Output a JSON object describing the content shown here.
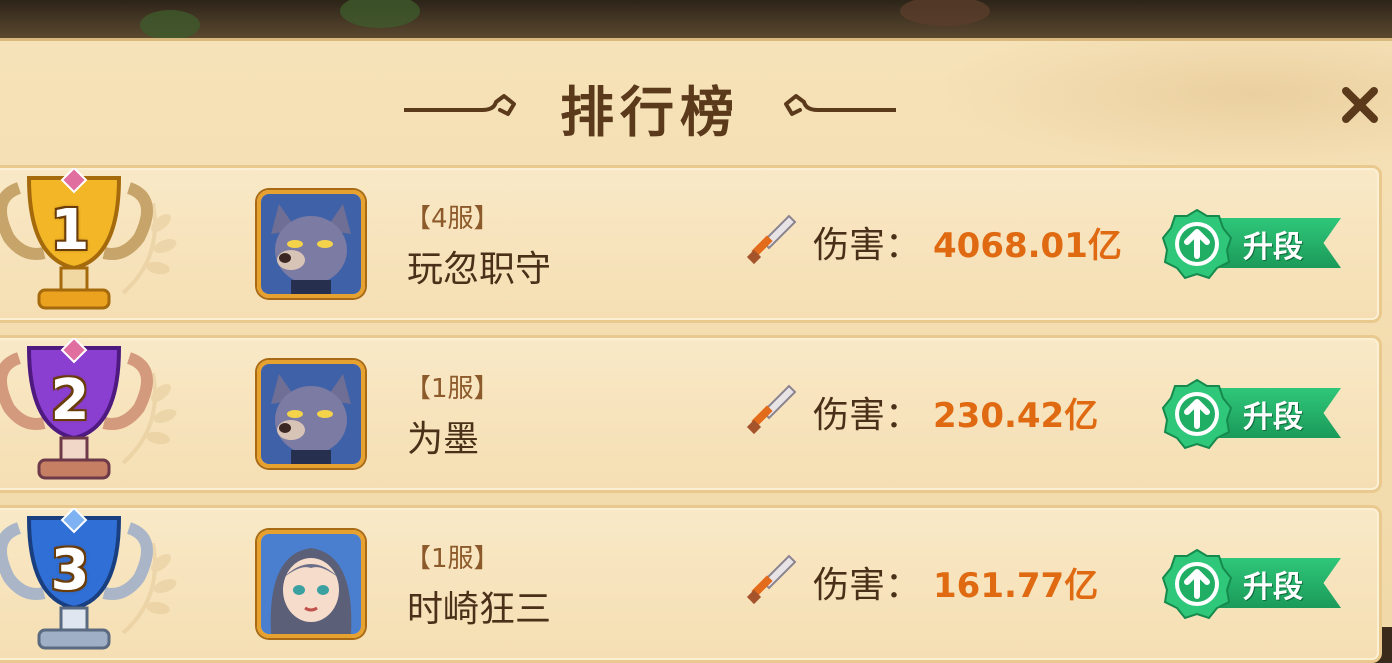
{
  "window": {
    "title": "排行榜",
    "close_label": "✕"
  },
  "leaderboard": {
    "damage_label": "伤害：",
    "rows": [
      {
        "rank": "1",
        "server": "【4服】",
        "name": "玩忽职守",
        "damage": "4068.01亿",
        "action_label": "升段",
        "trophy": "gold-trophy-icon",
        "avatar": "wolf-avatar"
      },
      {
        "rank": "2",
        "server": "【1服】",
        "name": "为墨",
        "damage": "230.42亿",
        "action_label": "升段",
        "trophy": "purple-trophy-icon",
        "avatar": "wolf-avatar"
      },
      {
        "rank": "3",
        "server": "【1服】",
        "name": "时崎狂三",
        "damage": "161.77亿",
        "action_label": "升段",
        "trophy": "blue-trophy-icon",
        "avatar": "girl-avatar"
      }
    ]
  },
  "colors": {
    "panel": "#f5deb2",
    "title": "#5b3a1c",
    "damage_value": "#e06a12",
    "upgrade_green": "#1b9a59",
    "gold": "#e7a12f",
    "purple": "#8a3fd1",
    "blue": "#2f6fd6"
  }
}
